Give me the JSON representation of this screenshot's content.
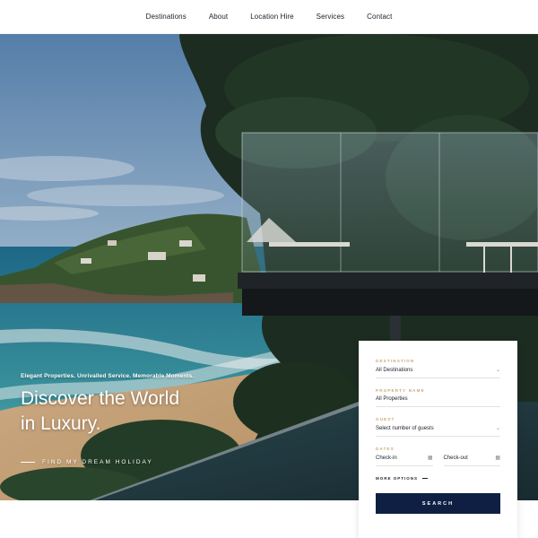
{
  "nav": {
    "items": [
      "Destinations",
      "About",
      "Location Hire",
      "Services",
      "Contact"
    ]
  },
  "hero": {
    "tagline": "Elegant Properties. Unrivalled Service. Memorable Moments.",
    "headline_line1": "Discover the World",
    "headline_line2": "in Luxury.",
    "cta": "FIND MY DREAM HOLIDAY"
  },
  "search": {
    "destination": {
      "label": "DESTINATION",
      "value": "All Destinations"
    },
    "property": {
      "label": "PROPERTY NAME",
      "value": "All Properties"
    },
    "guest": {
      "label": "GUEST",
      "value": "Select number of guests"
    },
    "dates": {
      "label": "DATES",
      "checkin": "Check-in",
      "checkout": "Check-out"
    },
    "more_options": "MORE OPTIONS",
    "button": "SEARCH"
  },
  "colors": {
    "accent_navy": "#0f1f44",
    "label_gold": "#c7a878"
  },
  "icons": {
    "dropdown": "chevron-down-icon",
    "calendar": "calendar-icon"
  }
}
